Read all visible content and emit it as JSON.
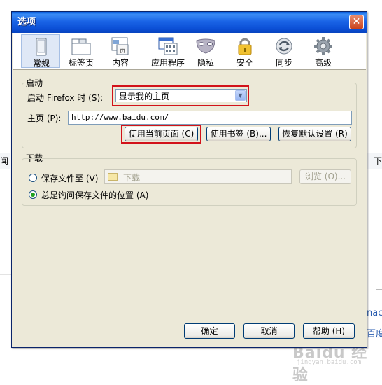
{
  "background": {
    "left_tab_text": "闻",
    "right_tab_text": "下",
    "right_link_1": "nac",
    "right_link_2": "百度",
    "watermark": "Baidu 经验",
    "watermark_sub": "jingyan.baidu.com"
  },
  "dialog": {
    "title": "选项",
    "close_symbol": "✕",
    "toolbar": [
      {
        "label": "常规",
        "icon": "general-icon"
      },
      {
        "label": "标签页",
        "icon": "tabs-icon"
      },
      {
        "label": "内容",
        "icon": "content-icon"
      },
      {
        "label": "应用程序",
        "icon": "applications-icon"
      },
      {
        "label": "隐私",
        "icon": "privacy-icon"
      },
      {
        "label": "安全",
        "icon": "security-icon"
      },
      {
        "label": "同步",
        "icon": "sync-icon"
      },
      {
        "label": "高级",
        "icon": "advanced-icon"
      }
    ],
    "startup": {
      "group_title": "启动",
      "when_label": "启动 Firefox 时 (S):",
      "when_value": "显示我的主页",
      "homepage_label": "主页 (P):",
      "homepage_value": "http://www.baidu.com/",
      "use_current": "使用当前页面 (C)",
      "use_bookmark": "使用书签 (B)...",
      "restore_default": "恢复默认设置 (R)"
    },
    "downloads": {
      "group_title": "下载",
      "save_to_label": "保存文件至 (V)",
      "folder_value": "下载",
      "browse": "浏览 (O)...",
      "always_ask_label": "总是询问保存文件的位置 (A)",
      "selected": "always_ask"
    },
    "footer": {
      "ok": "确定",
      "cancel": "取消",
      "help": "帮助 (H)"
    },
    "colors": {
      "highlight": "#d2121a",
      "titlebar": "#0b4fd6",
      "dialog_bg": "#ece9d8"
    }
  }
}
